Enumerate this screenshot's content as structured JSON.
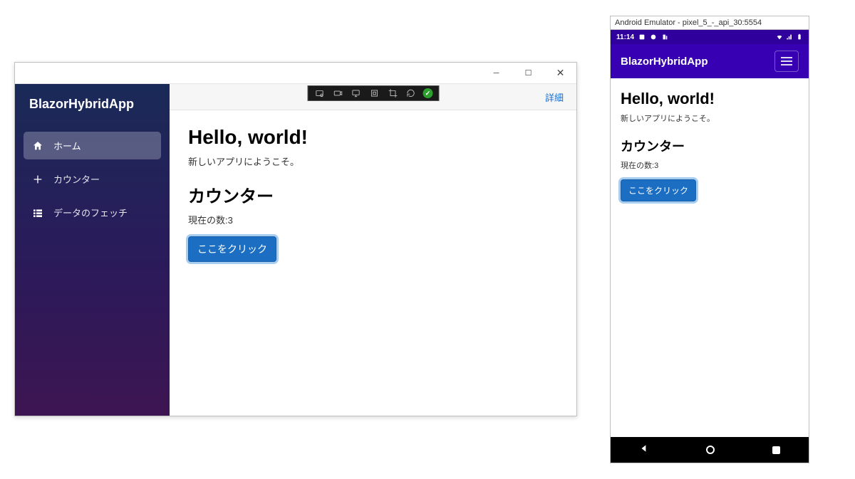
{
  "desktop": {
    "brand": "BlazorHybridApp",
    "sidebar": {
      "items": [
        {
          "label": "ホーム",
          "icon": "home-icon",
          "active": true
        },
        {
          "label": "カウンター",
          "icon": "plus-icon",
          "active": false
        },
        {
          "label": "データのフェッチ",
          "icon": "list-icon",
          "active": false
        }
      ]
    },
    "topbar": {
      "link": "詳細"
    },
    "content": {
      "title": "Hello, world!",
      "subtitle": "新しいアプリにようこそ。",
      "counter_heading": "カウンター",
      "counter_label": "現在の数:",
      "counter_value": "3",
      "button_label": "ここをクリック"
    }
  },
  "android": {
    "emulator_title": "Android Emulator - pixel_5_-_api_30:5554",
    "status": {
      "time": "11:14"
    },
    "appbar": {
      "title": "BlazorHybridApp"
    },
    "content": {
      "title": "Hello, world!",
      "subtitle": "新しいアプリにようこそ。",
      "counter_heading": "カウンター",
      "counter_label": "現在の数:",
      "counter_value": "3",
      "button_label": "ここをクリック"
    }
  }
}
